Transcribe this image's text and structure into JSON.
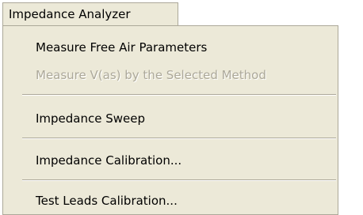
{
  "menubar": {
    "title": "Impedance Analyzer"
  },
  "menu": {
    "items": [
      {
        "label": "Measure Free Air Parameters",
        "enabled": true
      },
      {
        "label": "Measure V(as) by the Selected Method",
        "enabled": false
      },
      {
        "label": "Impedance Sweep",
        "enabled": true
      },
      {
        "label": "Impedance Calibration...",
        "enabled": true
      },
      {
        "label": "Test Leads Calibration...",
        "enabled": true
      }
    ]
  }
}
